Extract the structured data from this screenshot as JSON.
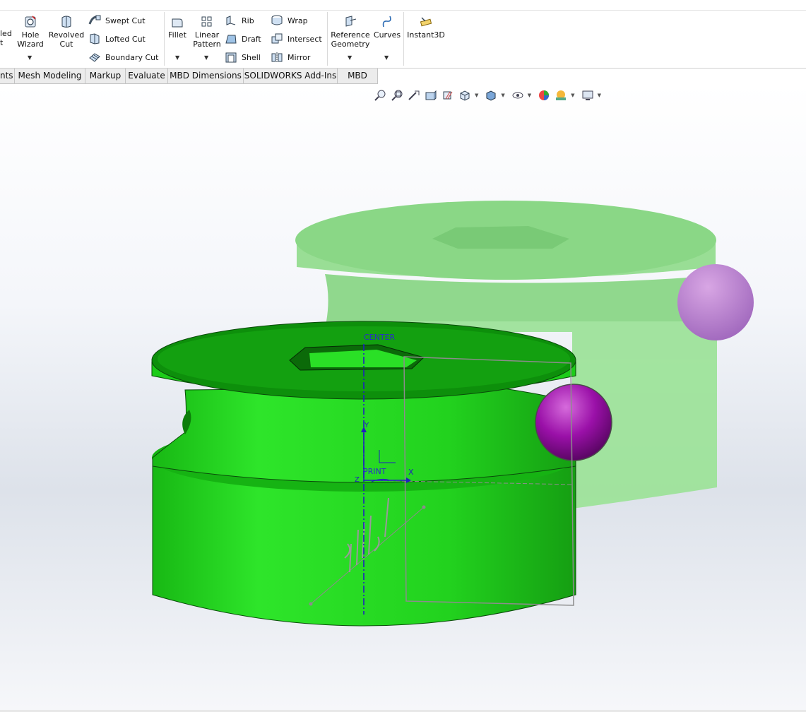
{
  "ribbon": {
    "partial_label_1": "led",
    "partial_label_2": "t",
    "hole_wizard": "Hole\nWizard",
    "revolved_cut": "Revolved\nCut",
    "swept_cut": "Swept Cut",
    "lofted_cut": "Lofted Cut",
    "boundary_cut": "Boundary Cut",
    "fillet": "Fillet",
    "linear_pattern": "Linear\nPattern",
    "rib": "Rib",
    "draft": "Draft",
    "shell": "Shell",
    "wrap": "Wrap",
    "intersect": "Intersect",
    "mirror": "Mirror",
    "reference_geometry": "Reference\nGeometry",
    "curves": "Curves",
    "instant3d": "Instant3D"
  },
  "tabs": [
    {
      "label": "nts"
    },
    {
      "label": "Mesh Modeling"
    },
    {
      "label": "Markup"
    },
    {
      "label": "Evaluate"
    },
    {
      "label": "MBD Dimensions"
    },
    {
      "label": "SOLIDWORKS Add-Ins"
    },
    {
      "label": "MBD"
    }
  ],
  "viewport": {
    "center_label": "CENTER",
    "print_label": "PRINT",
    "y_axis_label": "Y",
    "x_axis_label": "X",
    "z_axis_label": "Z",
    "colors": {
      "part_green": "#1fd61a",
      "part_green_dark": "#0a8f0a",
      "ghost_green": "#8fdc8a",
      "sphere_purple": "#9a10a8",
      "ghost_purple": "#b87ad0",
      "axis_blue": "#1f1fbf"
    }
  },
  "hud_icons": [
    "zoom-to-fit-icon",
    "zoom-area-icon",
    "previous-view-icon",
    "section-view-icon",
    "dynamic-annotation-icon",
    "view-orientation-icon",
    "display-style-icon",
    "hide-show-icon",
    "edit-appearance-icon",
    "apply-scene-icon",
    "view-settings-icon"
  ]
}
